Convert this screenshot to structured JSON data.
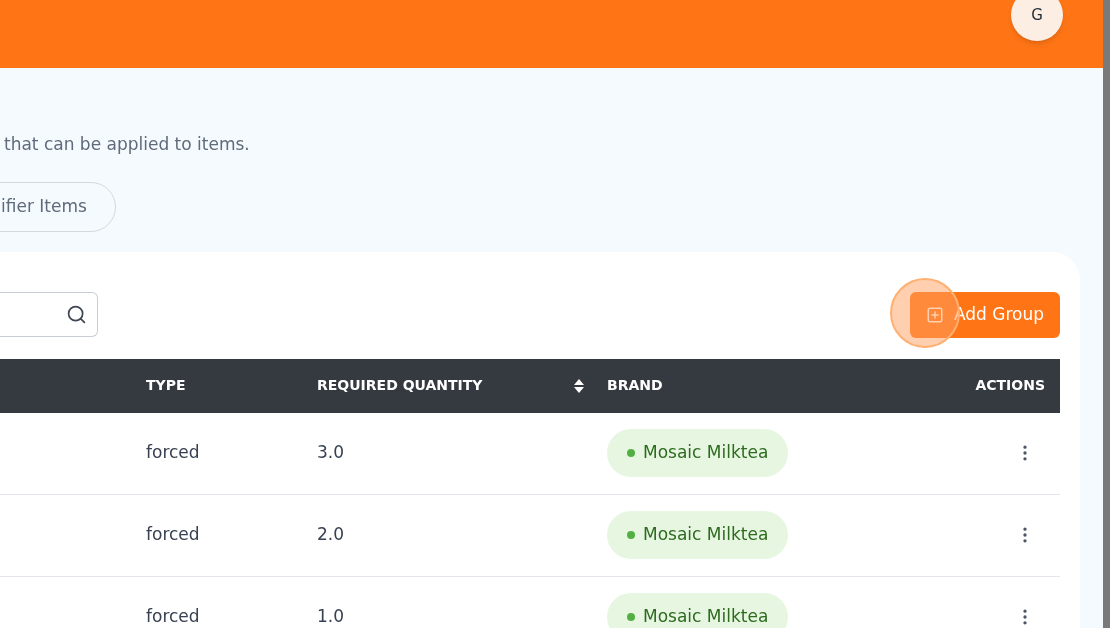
{
  "header": {
    "avatar_initial": "G"
  },
  "description": "that can be applied to items.",
  "tab_button": {
    "label": "ifier Items"
  },
  "toolbar": {
    "add_button": "Add Group"
  },
  "table": {
    "columns": [
      "TYPE",
      "REQUIRED QUANTITY",
      "BRAND",
      "ACTIONS"
    ],
    "rows": [
      {
        "type": "forced",
        "quantity": "3.0",
        "brand": {
          "label": "Mosaic Milktea",
          "color": "#52b043"
        }
      },
      {
        "type": "forced",
        "quantity": "2.0",
        "brand": {
          "label": "Mosaic Milktea",
          "color": "#52b043"
        }
      },
      {
        "type": "forced",
        "quantity": "1.0",
        "brand": {
          "label": "Mosaic Milktea",
          "color": "#52b043"
        }
      }
    ]
  }
}
